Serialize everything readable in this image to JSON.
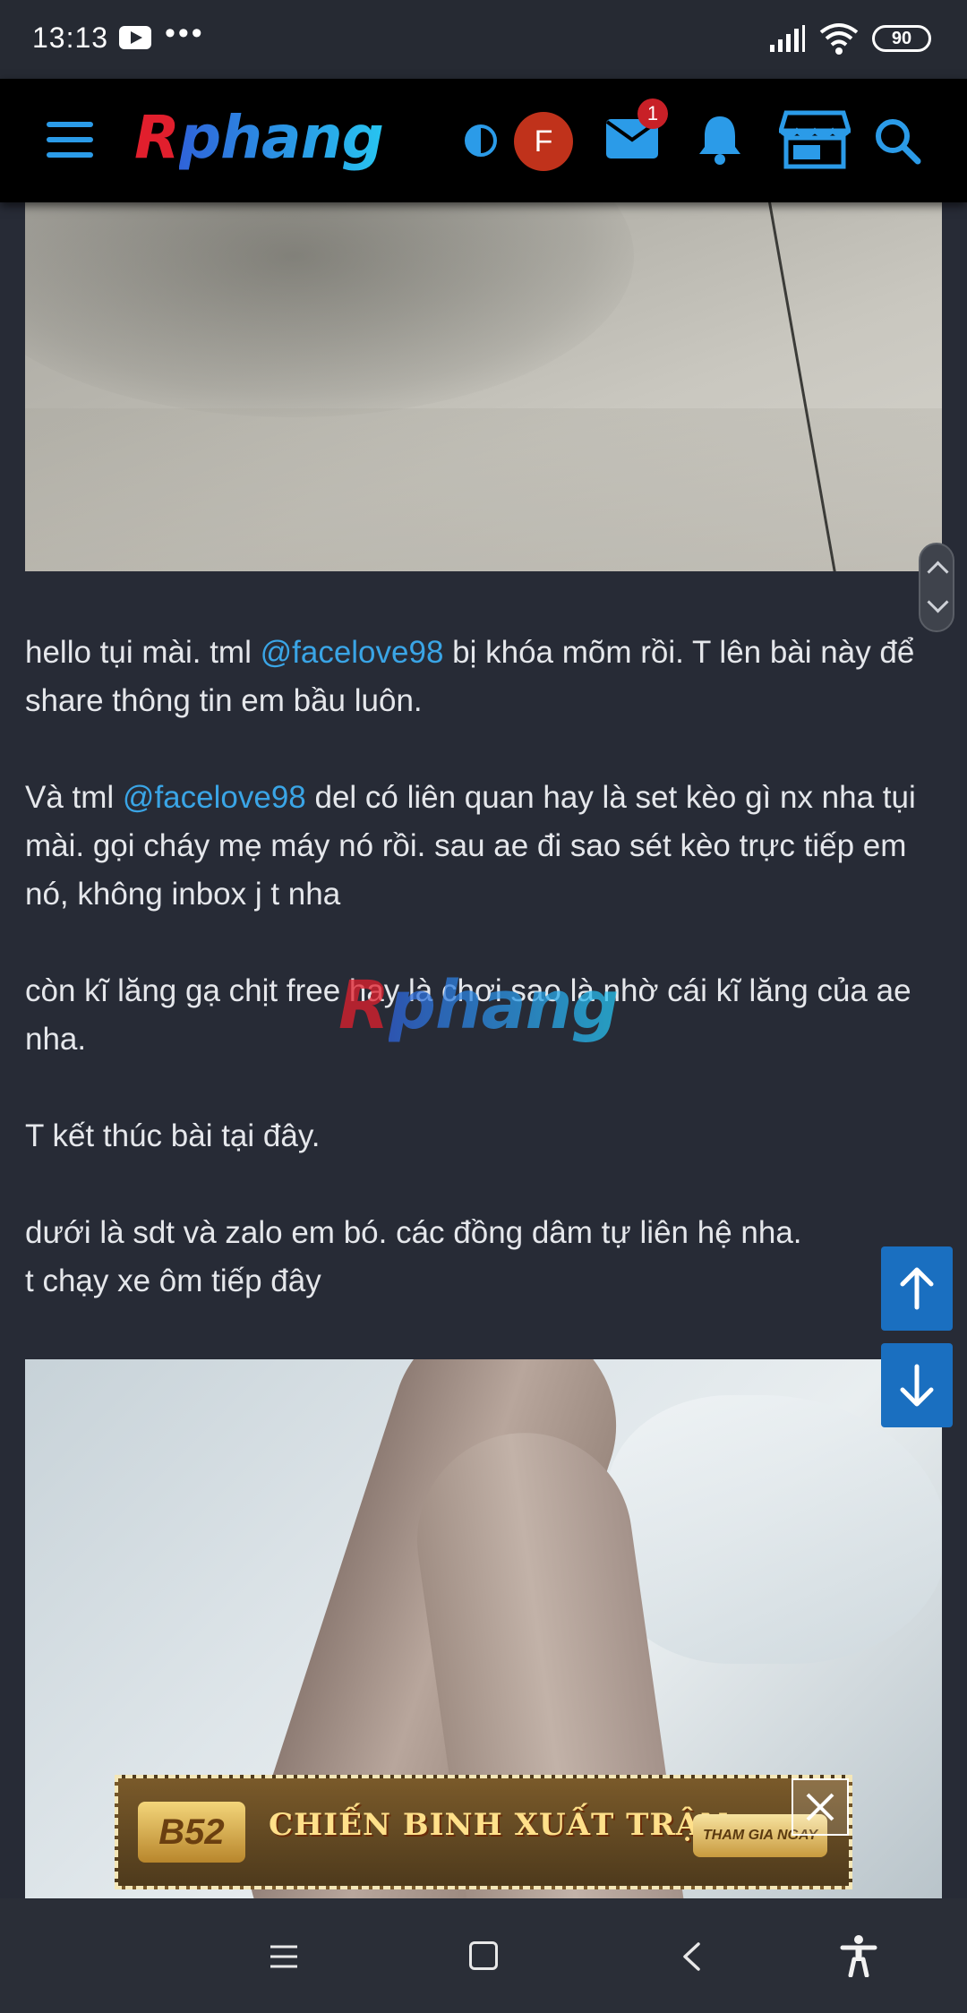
{
  "status_bar": {
    "time": "13:13",
    "more": "•••",
    "battery": "90",
    "icons": [
      "youtube-icon",
      "signal-icon",
      "wifi-icon",
      "battery-icon"
    ]
  },
  "header": {
    "logo_first": "R",
    "logo_rest": "phang",
    "avatar_letter": "F",
    "mail_badge": "1",
    "icons": [
      "hamburger-icon",
      "theme-toggle-icon",
      "mail-icon",
      "bell-icon",
      "store-icon",
      "search-icon"
    ],
    "accent_color": "#2b9be8"
  },
  "post": {
    "paragraphs": [
      {
        "before": "hello tụi mài. tml ",
        "mention": "@facelove98",
        "after": " bị khóa mõm rồi. T lên bài này để share thông tin em bầu luôn."
      },
      {
        "before": "Và tml ",
        "mention": "@facelove98",
        "after": " del có liên quan hay là set kèo gì nx nha tụi mài. gọi cháy mẹ máy nó rồi. sau ae đi sao sét kèo trực tiếp em nó, không inbox j t nha"
      },
      {
        "text": "còn kĩ lăng gạ chịt free hay là chơi sao là nhờ cái kĩ lăng của ae nha."
      },
      {
        "text": "T kết thúc bài tại đây."
      },
      {
        "line1": "dưới là sdt và zalo em bó. các đồng dâm tự liên hệ nha.",
        "line2": "t chạy xe ôm tiếp đây"
      }
    ],
    "watermark_first": "R",
    "watermark_rest": "phang",
    "mention_color": "#3aa5e6"
  },
  "ad": {
    "logo": "B52",
    "title": "CHIẾN BINH XUẤT TRẬN",
    "cta": "THAM GIA NGAY"
  },
  "nav": {
    "icons": [
      "menu-icon",
      "home-icon",
      "back-icon",
      "accessibility-icon"
    ]
  }
}
